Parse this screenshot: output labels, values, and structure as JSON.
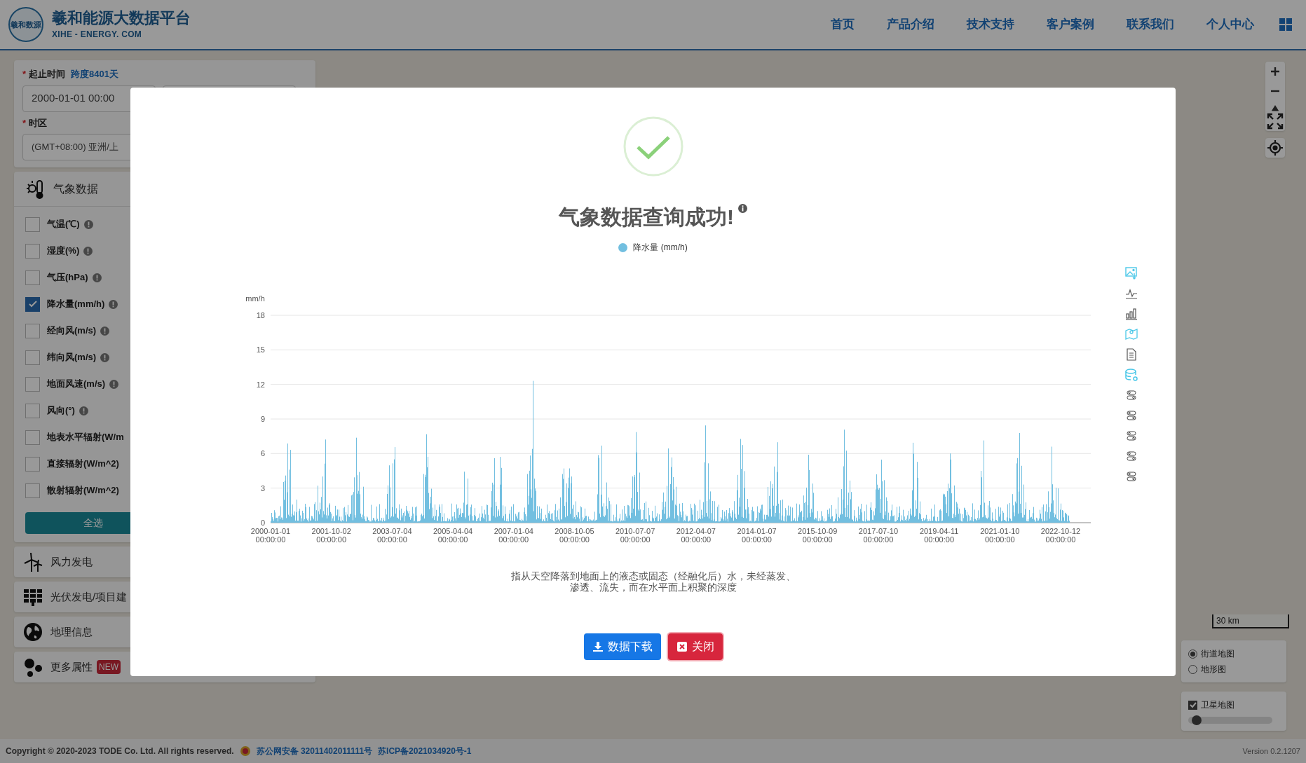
{
  "header": {
    "logo_text": "羲和数源",
    "title": "羲和能源大数据平台",
    "subtitle": "XIHE - ENERGY. COM",
    "nav": [
      {
        "label": "首页"
      },
      {
        "label": "产品介绍"
      },
      {
        "label": "技术支持"
      },
      {
        "label": "客户案例"
      },
      {
        "label": "联系我们"
      },
      {
        "label": "个人中心"
      }
    ]
  },
  "left_panel": {
    "time_range": {
      "mark": "*",
      "label": "起止时间",
      "span": "跨度8401天",
      "start": "2000-01-01 00:00"
    },
    "timezone": {
      "mark": "*",
      "label": "时区",
      "value": "(GMT+08:00) 亚洲/上"
    },
    "weather": {
      "title": "气象数据",
      "variables": [
        {
          "label": "气温(℃)",
          "checked": false,
          "info": true
        },
        {
          "label": "湿度(%)",
          "checked": false,
          "info": true
        },
        {
          "label": "气压(hPa)",
          "checked": false,
          "info": true
        },
        {
          "label": "降水量(mm/h)",
          "checked": true,
          "info": true
        },
        {
          "label": "经向风(m/s)",
          "checked": false,
          "info": true
        },
        {
          "label": "纬向风(m/s)",
          "checked": false,
          "info": true
        },
        {
          "label": "地面风速(m/s)",
          "checked": false,
          "info": true
        },
        {
          "label": "风向(°)",
          "checked": false,
          "info": true
        },
        {
          "label": "地表水平辐射(W/m",
          "checked": false,
          "info": false
        },
        {
          "label": "直接辐射(W/m^2)",
          "checked": false,
          "info": false
        },
        {
          "label": "散射辐射(W/m^2)",
          "checked": false,
          "info": false
        }
      ],
      "select_all": "全选"
    },
    "sections": [
      {
        "title": "风力发电",
        "kind": "wind"
      },
      {
        "title": "光伏发电/项目建",
        "kind": "solar"
      },
      {
        "title": "地理信息",
        "kind": "globe"
      },
      {
        "title": "更多属性",
        "kind": "dots",
        "badge": "NEW"
      }
    ]
  },
  "map_controls": {
    "scale": "30 km",
    "map_types": [
      {
        "label": "街道地图",
        "selected": true
      },
      {
        "label": "地形图",
        "selected": false
      }
    ],
    "satellite": {
      "label": "卫星地图",
      "checked": true,
      "level": 0.05
    }
  },
  "modal": {
    "title": "气象数据查询成功!",
    "legend": "降水量 (mm/h)",
    "chart": {
      "y_unit": "mm/h",
      "y_ticks": [
        "18",
        "15",
        "12",
        "9",
        "6",
        "3",
        "0"
      ],
      "x_ticks": [
        {
          "date": "2000-01-01",
          "time": "00:00:00"
        },
        {
          "date": "2001-10-02",
          "time": "00:00:00"
        },
        {
          "date": "2003-07-04",
          "time": "00:00:00"
        },
        {
          "date": "2005-04-04",
          "time": "00:00:00"
        },
        {
          "date": "2007-01-04",
          "time": "00:00:00"
        },
        {
          "date": "2008-10-05",
          "time": "00:00:00"
        },
        {
          "date": "2010-07-07",
          "time": "00:00:00"
        },
        {
          "date": "2012-04-07",
          "time": "00:00:00"
        },
        {
          "date": "2014-01-07",
          "time": "00:00:00"
        },
        {
          "date": "2015-10-09",
          "time": "00:00:00"
        },
        {
          "date": "2017-07-10",
          "time": "00:00:00"
        },
        {
          "date": "2019-04-11",
          "time": "00:00:00"
        },
        {
          "date": "2021-01-10",
          "time": "00:00:00"
        },
        {
          "date": "2022-10-12",
          "time": "00:00:00"
        }
      ]
    },
    "description": "指从天空降落到地面上的液态或固态（经融化后）水，未经蒸发、渗透、流失，而在水平面上积聚的深度",
    "buttons": [
      {
        "label": "数据下载",
        "kind": "download"
      },
      {
        "label": "关闭",
        "kind": "close"
      }
    ]
  },
  "footer": {
    "copyright": "Copyright © 2020-2023 **TODE** Co. Ltd. All rights reserved.",
    "links": [
      "苏公网安备 32011402011111号",
      "苏ICP备2021034920号-1"
    ],
    "version": "Version 0.2.1207"
  }
}
